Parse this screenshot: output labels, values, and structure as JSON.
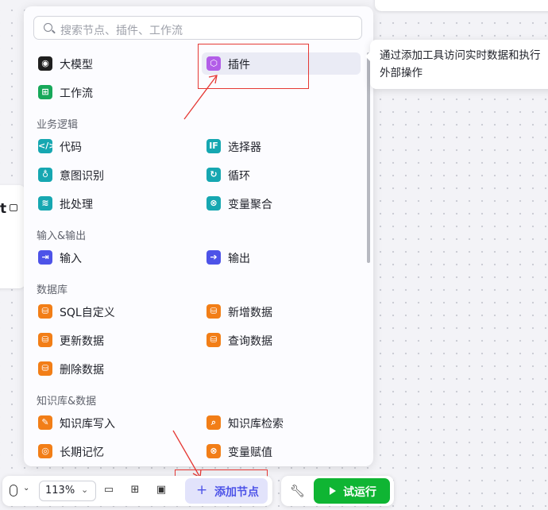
{
  "search": {
    "placeholder": "搜索节点、插件、工作流"
  },
  "top_items": [
    {
      "label": "大模型",
      "icon": "llm-icon",
      "color": "#1f1f1f"
    },
    {
      "label": "插件",
      "icon": "plugin-cube-icon",
      "color": "#b25de8"
    },
    {
      "label": "工作流",
      "icon": "workflow-icon",
      "color": "#17a85a"
    }
  ],
  "sections": [
    {
      "title": "业务逻辑",
      "items": [
        {
          "label": "代码",
          "icon": "code-icon",
          "color": "#16a7b1"
        },
        {
          "label": "选择器",
          "icon": "if-icon",
          "color": "#16a7b1"
        },
        {
          "label": "意图识别",
          "icon": "intent-icon",
          "color": "#16a7b1"
        },
        {
          "label": "循环",
          "icon": "loop-icon",
          "color": "#16a7b1"
        },
        {
          "label": "批处理",
          "icon": "batch-icon",
          "color": "#16a7b1"
        },
        {
          "label": "变量聚合",
          "icon": "variable-merge-icon",
          "color": "#16a7b1"
        }
      ]
    },
    {
      "title": "输入&输出",
      "items": [
        {
          "label": "输入",
          "icon": "input-icon",
          "color": "#4d53e8"
        },
        {
          "label": "输出",
          "icon": "output-icon",
          "color": "#4d53e8"
        }
      ]
    },
    {
      "title": "数据库",
      "items": [
        {
          "label": "SQL自定义",
          "icon": "database-icon",
          "color": "#f27e17"
        },
        {
          "label": "新增数据",
          "icon": "database-add-icon",
          "color": "#f27e17"
        },
        {
          "label": "更新数据",
          "icon": "database-update-icon",
          "color": "#f27e17"
        },
        {
          "label": "查询数据",
          "icon": "database-query-icon",
          "color": "#f27e17"
        },
        {
          "label": "删除数据",
          "icon": "database-delete-icon",
          "color": "#f27e17"
        }
      ]
    },
    {
      "title": "知识库&数据",
      "items": [
        {
          "label": "知识库写入",
          "icon": "knowledge-write-icon",
          "color": "#f27e17"
        },
        {
          "label": "知识库检索",
          "icon": "knowledge-search-icon",
          "color": "#f27e17"
        },
        {
          "label": "长期记忆",
          "icon": "memory-icon",
          "color": "#f27e17"
        },
        {
          "label": "变量赋值",
          "icon": "variable-assign-icon",
          "color": "#f27e17"
        }
      ]
    }
  ],
  "tooltip": {
    "text": "通过添加工具访问实时数据和执行外部操作"
  },
  "toolbar": {
    "zoom": "113%",
    "add_node_label": "添加节点",
    "run_label": "试运行"
  },
  "colors": {
    "accent": "#4d53e8",
    "run": "#0fb533",
    "highlight": "#e53935"
  }
}
